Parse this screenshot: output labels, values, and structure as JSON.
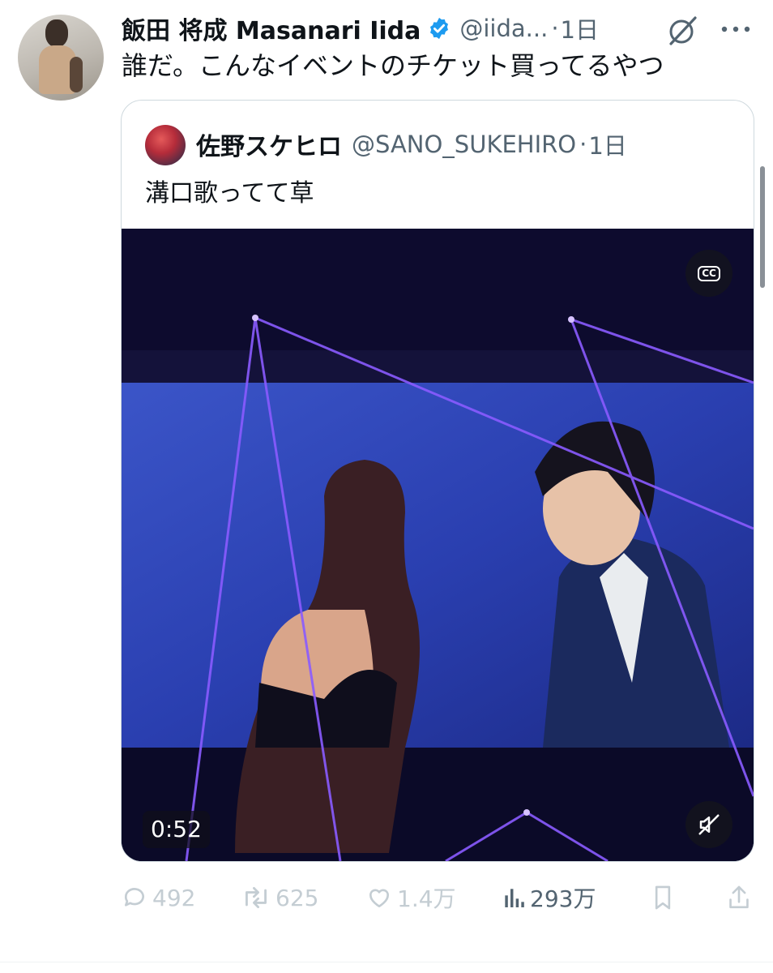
{
  "tweet": {
    "display_name": "飯田 将成 Masanari Iida",
    "handle": "@iida...",
    "separator": "·",
    "time": "1日",
    "text": "誰だ。こんなイベントのチケット買ってるやつ",
    "verified_color": "#1d9bf0"
  },
  "quote": {
    "display_name": "佐野スケヒロ",
    "handle": "@SANO_SUKEHIRO",
    "separator": "·",
    "time": "1日",
    "text": "溝口歌ってて草",
    "video": {
      "duration": "0:52",
      "cc_label": "CC",
      "icons": [
        "closed-captions-icon",
        "mute-icon"
      ]
    }
  },
  "actions": {
    "replies": "492",
    "reposts": "625",
    "likes": "1.4万",
    "views": "293万"
  },
  "colors": {
    "text": "#0f1419",
    "secondary": "#536471",
    "muted": "#c4cdd3",
    "border": "#cfd9de"
  },
  "icons": [
    "grok-icon",
    "more-icon",
    "verified-badge-icon",
    "reply-icon",
    "repost-icon",
    "like-icon",
    "views-icon",
    "bookmark-icon",
    "share-icon"
  ]
}
